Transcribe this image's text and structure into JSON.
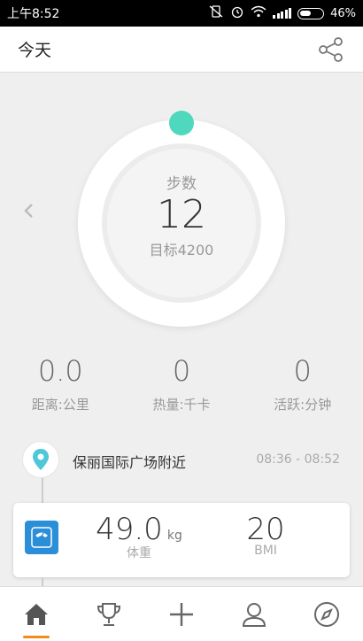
{
  "status_bar": {
    "time": "上午8:52",
    "battery": "46%"
  },
  "header": {
    "title": "今天"
  },
  "steps": {
    "label": "步数",
    "value": "12",
    "target": "目标4200"
  },
  "stats": [
    {
      "value": "0.0",
      "label": "距离:公里"
    },
    {
      "value": "0",
      "label": "热量:千卡"
    },
    {
      "value": "0",
      "label": "活跃:分钟"
    }
  ],
  "location": {
    "name": "保丽国际广场附近",
    "time": "08:36 - 08:52"
  },
  "weight": {
    "value": "49.0",
    "unit": "kg",
    "label": "体重",
    "bmi_value": "20",
    "bmi_label": "BMI"
  },
  "colors": {
    "accent": "#4fd8bd",
    "tab_active": "#f28a1e",
    "scale": "#2a8fd8",
    "location": "#4ec7d8"
  },
  "tabs": [
    "home-icon",
    "trophy-icon",
    "plus-icon",
    "profile-icon",
    "compass-icon"
  ]
}
